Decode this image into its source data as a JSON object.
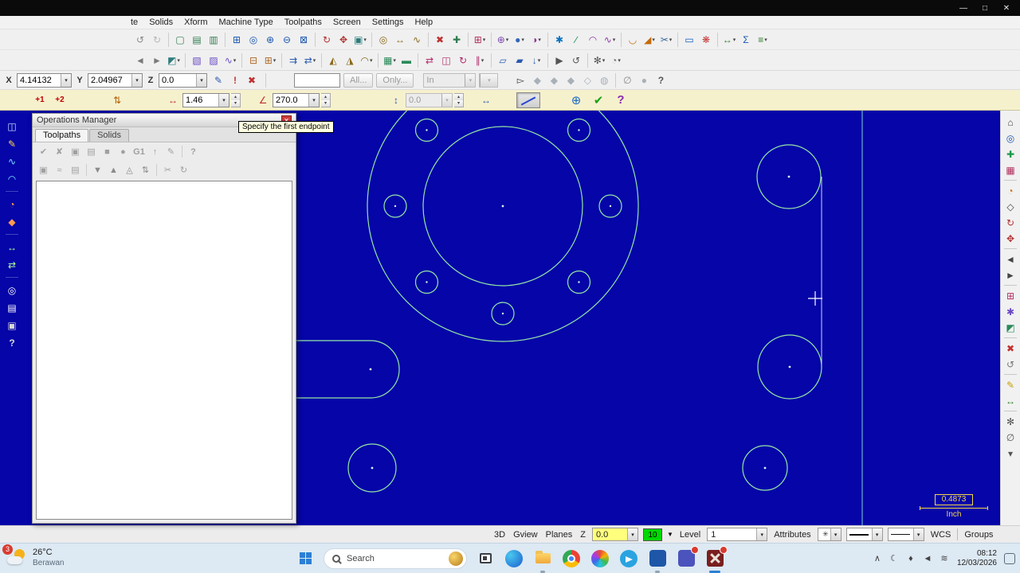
{
  "window": {
    "controls": [
      {
        "n": "minimize-button",
        "g": "—",
        "c": "#e8e8e8"
      },
      {
        "n": "maximize-button",
        "g": "□",
        "c": "#e8e8e8"
      },
      {
        "n": "close-button",
        "g": "✕",
        "c": "#e8e8e8"
      }
    ]
  },
  "menubar": {
    "items": [
      "te",
      "Solids",
      "Xform",
      "Machine Type",
      "Toolpaths",
      "Screen",
      "Settings",
      "Help"
    ]
  },
  "toolbar1": {
    "icons": [
      {
        "n": "undo-icon",
        "g": "↺",
        "c": "#8a8a8a"
      },
      {
        "n": "redo-icon",
        "g": "↻",
        "c": "#b8b8b8"
      },
      {
        "s": 1
      },
      {
        "n": "new-file-icon",
        "g": "▢",
        "c": "#2f7d4f"
      },
      {
        "n": "open-file-icon",
        "g": "▤",
        "c": "#2f7d4f"
      },
      {
        "n": "save-file-icon",
        "g": "▥",
        "c": "#2f7d4f"
      },
      {
        "s": 1
      },
      {
        "n": "zoom-window-icon",
        "g": "⊞",
        "c": "#1a56b0"
      },
      {
        "n": "zoom-target-icon",
        "g": "◎",
        "c": "#1a56b0"
      },
      {
        "n": "zoom-in-icon",
        "g": "⊕",
        "c": "#1a56b0"
      },
      {
        "n": "zoom-out-icon",
        "g": "⊖",
        "c": "#1a56b0"
      },
      {
        "n": "zoom-fit-icon",
        "g": "⊠",
        "c": "#1a56b0"
      },
      {
        "s": 1
      },
      {
        "n": "dynamic-rotate-icon",
        "g": "↻",
        "c": "#b03030"
      },
      {
        "n": "pan-icon",
        "g": "✥",
        "c": "#b03030"
      },
      {
        "n": "repaint-icon",
        "g": "▣",
        "c": "#2e7d7d",
        "d": 1
      },
      {
        "s": 1
      },
      {
        "n": "analyze-position-icon",
        "g": "◎",
        "c": "#8a6a1a"
      },
      {
        "n": "analyze-distance-icon",
        "g": "↔",
        "c": "#8a6a1a"
      },
      {
        "n": "analyze-dynamic-icon",
        "g": "∿",
        "c": "#8a6a1a"
      },
      {
        "s": 1
      },
      {
        "n": "delete-entities-icon",
        "g": "✖",
        "c": "#c03030"
      },
      {
        "n": "undelete-icon",
        "g": "✚",
        "c": "#2f7d4f"
      },
      {
        "s": 1
      },
      {
        "n": "grid-settings-icon",
        "g": "⊞",
        "c": "#b03060",
        "d": 1
      },
      {
        "s": 1
      },
      {
        "n": "wcs-origin-icon",
        "g": "⊕",
        "c": "#7a4ab0",
        "d": 1
      },
      {
        "n": "view-sphere-icon",
        "g": "●",
        "c": "#3366bb",
        "d": 1
      },
      {
        "n": "plane-select-icon",
        "g": "◑",
        "c": "#993399",
        "d": 1
      },
      {
        "s": 1
      },
      {
        "n": "create-point-icon",
        "g": "✱",
        "c": "#0a74c4"
      },
      {
        "n": "create-line-icon",
        "g": "∕",
        "c": "#0a8a4a"
      },
      {
        "n": "create-arc-icon",
        "g": "◠",
        "c": "#8a3aa0"
      },
      {
        "n": "create-spline-icon",
        "g": "∿",
        "c": "#8a3aa0",
        "d": 1
      },
      {
        "s": 1
      },
      {
        "n": "create-fillet-icon",
        "g": "◡",
        "c": "#c46a0a"
      },
      {
        "n": "create-chamfer-icon",
        "g": "◢",
        "c": "#c46a0a",
        "d": 1
      },
      {
        "n": "trim-break-icon",
        "g": "✂",
        "c": "#3a6aa0",
        "d": 1
      },
      {
        "s": 1
      },
      {
        "n": "create-rectangle-icon",
        "g": "▭",
        "c": "#0a5ac4"
      },
      {
        "n": "create-letters-icon",
        "g": "❋",
        "c": "#c43a3a"
      },
      {
        "s": 1
      },
      {
        "n": "dimension-icon",
        "g": "↔",
        "c": "#2a7d2a",
        "d": 1
      },
      {
        "n": "sigma-icon",
        "g": "Σ",
        "c": "#1a56b0"
      },
      {
        "n": "list-view-icon",
        "g": "≡",
        "c": "#2a7d2a",
        "d": 1
      }
    ]
  },
  "toolbar2": {
    "icons": [
      {
        "n": "prev-view-icon",
        "g": "◄",
        "c": "#7a7a7a"
      },
      {
        "n": "next-view-icon",
        "g": "►",
        "c": "#7a7a7a"
      },
      {
        "n": "view-manager-icon",
        "g": "◩",
        "c": "#2e7d7d",
        "d": 1
      },
      {
        "s": 1
      },
      {
        "n": "select-window-icon",
        "g": "▧",
        "c": "#6a4ac4"
      },
      {
        "n": "select-polygon-icon",
        "g": "▨",
        "c": "#6a4ac4"
      },
      {
        "n": "select-chain-icon",
        "g": "∿",
        "c": "#6a4ac4",
        "d": 1
      },
      {
        "s": 1
      },
      {
        "n": "group-create-icon",
        "g": "⊟",
        "c": "#b06a2a"
      },
      {
        "n": "group-manage-icon",
        "g": "⊞",
        "c": "#b06a2a",
        "d": 1
      },
      {
        "s": 1
      },
      {
        "n": "level-move-icon",
        "g": "⇉",
        "c": "#2a5ab0"
      },
      {
        "n": "level-copy-icon",
        "g": "⇄",
        "c": "#2a5ab0",
        "d": 1
      },
      {
        "s": 1
      },
      {
        "n": "solid-extrude-icon",
        "g": "◭",
        "c": "#8a6a1a"
      },
      {
        "n": "solid-revolve-icon",
        "g": "◮",
        "c": "#8a6a1a"
      },
      {
        "n": "solid-sweep-icon",
        "g": "◠",
        "c": "#8a6a1a",
        "d": 1
      },
      {
        "s": 1
      },
      {
        "n": "surface-net-icon",
        "g": "▦",
        "c": "#2a8a5a",
        "d": 1
      },
      {
        "n": "surface-flat-icon",
        "g": "▬",
        "c": "#2a8a5a"
      },
      {
        "s": 1
      },
      {
        "n": "xform-translate-icon",
        "g": "⇄",
        "c": "#b02a6a"
      },
      {
        "n": "xform-mirror-icon",
        "g": "◫",
        "c": "#b02a6a"
      },
      {
        "n": "xform-rotate-icon",
        "g": "↻",
        "c": "#b02a6a"
      },
      {
        "n": "xform-offset-icon",
        "g": "∥",
        "c": "#b02a6a",
        "d": 1
      },
      {
        "s": 1
      },
      {
        "n": "toolpath-contour-icon",
        "g": "▱",
        "c": "#2a5ab0"
      },
      {
        "n": "toolpath-pocket-icon",
        "g": "▰",
        "c": "#2a5ab0"
      },
      {
        "n": "toolpath-drill-icon",
        "g": "↓",
        "c": "#2a5ab0",
        "d": 1
      },
      {
        "s": 1
      },
      {
        "n": "machine-sim-icon",
        "g": "▶",
        "c": "#555555"
      },
      {
        "n": "backplot-icon",
        "g": "↺",
        "c": "#555555"
      },
      {
        "s": 1
      },
      {
        "n": "config-icon",
        "g": "✻",
        "c": "#555555",
        "d": 1
      },
      {
        "n": "ribbon-more-icon",
        "g": "◔",
        "c": "#777777",
        "d": 1
      }
    ]
  },
  "autocursor": {
    "x_label": "X",
    "x_value": "4.14132",
    "y_label": "Y",
    "y_value": "2.04967",
    "z_label": "Z",
    "z_value": "0.0",
    "all_label": "All...",
    "only_label": "Only...",
    "in_label": "In",
    "left_icons": [
      {
        "n": "fastpoint-icon",
        "g": "✎",
        "c": "#2a5ab0"
      },
      {
        "n": "autocursor-config-icon",
        "g": "!",
        "c": "#c03030",
        "k": "bold"
      },
      {
        "n": "override-icon",
        "g": "✖",
        "c": "#c03030"
      }
    ],
    "right_icons": [
      {
        "n": "select-arrow-icon",
        "g": "▻",
        "c": "#3a3a3a"
      },
      {
        "n": "quickmask-endpoint-icon",
        "g": "◆",
        "c": "#a8b0b8"
      },
      {
        "n": "quickmask-center-icon",
        "g": "◆",
        "c": "#a8b0b8"
      },
      {
        "n": "quickmask-intersect-icon",
        "g": "◆",
        "c": "#a8b0b8"
      },
      {
        "n": "quickmask-quadrant-icon",
        "g": "◇",
        "c": "#a8b0b8"
      },
      {
        "n": "select-inside-icon",
        "g": "◍",
        "c": "#a8b0b8"
      },
      {
        "s": 1
      },
      {
        "n": "select-none-icon",
        "g": "∅",
        "c": "#8a8a8a"
      },
      {
        "n": "select-sphere-icon",
        "g": "●",
        "c": "#a8b0b8"
      },
      {
        "n": "autocursor-help-icon",
        "g": "?",
        "c": "#555555",
        "k": "bold"
      }
    ]
  },
  "ribbon": {
    "length_value": "1.46",
    "angle_value": "270.0",
    "z_value": "0.0",
    "group1": [
      {
        "n": "first-endpoint-icon",
        "g": "+1",
        "c": "#c00000",
        "k": "wide"
      },
      {
        "n": "second-endpoint-icon",
        "g": "+2",
        "c": "#c00000",
        "k": "wide"
      }
    ],
    "group2": [
      {
        "n": "tangent-lines-icon",
        "g": "⇅",
        "c": "#b05a00"
      }
    ],
    "group3": [
      {
        "n": "length-icon",
        "g": "↔",
        "c": "#c03030"
      }
    ],
    "group4": [
      {
        "n": "angle-icon",
        "g": "∠",
        "c": "#c03030"
      }
    ],
    "group5": [
      {
        "n": "z-depth-icon",
        "g": "↕",
        "c": "#2a5ab0"
      }
    ],
    "group6": [
      {
        "n": "offset-direction-icon",
        "g": "↔",
        "c": "#2a5ab0"
      }
    ],
    "group7": [
      {
        "n": "apply-icon",
        "g": "⊕",
        "c": "#1a6ac4",
        "k": "big"
      },
      {
        "n": "ok-icon",
        "g": "✔",
        "c": "#17a317",
        "k": "big"
      },
      {
        "n": "ribbon-help-icon",
        "g": "?",
        "c": "#8a2ab0",
        "k": "big bold"
      }
    ]
  },
  "tooltip": {
    "text": "Specify the first endpoint"
  },
  "ops_manager": {
    "title": "Operations Manager",
    "tabs": [
      "Toolpaths",
      "Solids"
    ],
    "toolbar1": [
      {
        "n": "ops-select-all-icon",
        "g": "✔",
        "c": "#a0a0a0"
      },
      {
        "n": "ops-select-none-icon",
        "g": "✘",
        "c": "#a0a0a0"
      },
      {
        "n": "ops-toggle-lock-icon",
        "g": "▣",
        "c": "#a0a0a0"
      },
      {
        "n": "ops-toggle-post-icon",
        "g": "▤",
        "c": "#a0a0a0"
      },
      {
        "n": "ops-fill-icon",
        "g": "■",
        "c": "#a0a0a0"
      },
      {
        "n": "ops-circle-icon",
        "g": "●",
        "c": "#a0a0a0"
      },
      {
        "n": "ops-g1-icon",
        "g": "G1",
        "c": "#a0a0a0",
        "k": "wide"
      },
      {
        "n": "ops-post-icon",
        "g": "↑",
        "c": "#a0a0a0"
      },
      {
        "n": "ops-edit-icon",
        "g": "✎",
        "c": "#a0a0a0"
      },
      {
        "s": 1
      },
      {
        "n": "ops-help-icon",
        "g": "?",
        "c": "#a0a0a0",
        "k": "bold"
      }
    ],
    "toolbar2": [
      {
        "n": "ops-lock-icon",
        "g": "▣",
        "c": "#a0a0a0"
      },
      {
        "n": "ops-wave-icon",
        "g": "≈",
        "c": "#a0a0a0"
      },
      {
        "n": "ops-save-icon",
        "g": "▤",
        "c": "#a0a0a0"
      },
      {
        "s": 1
      },
      {
        "n": "ops-move-down-icon",
        "g": "▼",
        "c": "#8a8a8a"
      },
      {
        "n": "ops-move-up-icon",
        "g": "▲",
        "c": "#8a8a8a"
      },
      {
        "n": "ops-insert-icon",
        "g": "◬",
        "c": "#8a8a8a"
      },
      {
        "n": "ops-swap-icon",
        "g": "⇅",
        "c": "#8a8a8a"
      },
      {
        "s": 1
      },
      {
        "n": "ops-cut-icon",
        "g": "✂",
        "c": "#a0a0a0"
      },
      {
        "n": "ops-regen-icon",
        "g": "↻",
        "c": "#a0a0a0"
      }
    ]
  },
  "left_toolbar": {
    "icons": [
      {
        "n": "side-analyze-icon",
        "g": "◫",
        "c": "#cfe0ff"
      },
      {
        "n": "side-sketch-icon",
        "g": "✎",
        "c": "#ffd34d"
      },
      {
        "n": "side-curve-icon",
        "g": "∿",
        "c": "#7ae0ff"
      },
      {
        "n": "side-arc-icon",
        "g": "◠",
        "c": "#7ae0ff"
      },
      {
        "s": 1
      },
      {
        "n": "side-surface-icon",
        "g": "◔",
        "c": "#ff9a4d"
      },
      {
        "n": "side-solid-icon",
        "g": "◆",
        "c": "#ff9a4d"
      },
      {
        "s": 1
      },
      {
        "n": "side-dimension-icon",
        "g": "↔",
        "c": "#b0ff9a"
      },
      {
        "n": "side-xform-icon",
        "g": "⇄",
        "c": "#b0ff9a"
      },
      {
        "s": 1
      },
      {
        "n": "side-view-icon",
        "g": "◎",
        "c": "#ffffff"
      },
      {
        "n": "side-level-icon",
        "g": "▤",
        "c": "#ffffff"
      },
      {
        "n": "side-screen-icon",
        "g": "▣",
        "c": "#d8d8d8"
      },
      {
        "n": "side-help-icon",
        "g": "?",
        "c": "#d8d8d8",
        "k": "bold"
      }
    ]
  },
  "right_toolbar": {
    "icons": [
      {
        "n": "fit-screen-icon",
        "g": "⌂",
        "c": "#444444"
      },
      {
        "n": "zoom-selected-icon",
        "g": "◎",
        "c": "#1a56b0"
      },
      {
        "n": "repaint-screen-icon",
        "g": "✚",
        "c": "#1a9a4a"
      },
      {
        "n": "blank-entity-icon",
        "g": "▦",
        "c": "#b03060"
      },
      {
        "s": 1
      },
      {
        "n": "shade-icon",
        "g": "◔",
        "c": "#c46a0a"
      },
      {
        "n": "wireframe-icon",
        "g": "◇",
        "c": "#444444"
      },
      {
        "n": "rotate-view-icon",
        "g": "↻",
        "c": "#b03030"
      },
      {
        "n": "pan-view-icon",
        "g": "✥",
        "c": "#b03030"
      },
      {
        "s": 1
      },
      {
        "n": "previous-view-icon",
        "g": "◄",
        "c": "#444444"
      },
      {
        "n": "next-view2-icon",
        "g": "►",
        "c": "#444444"
      },
      {
        "s": 1
      },
      {
        "n": "grid-toggle-icon",
        "g": "⊞",
        "c": "#b03060"
      },
      {
        "n": "attributes-icon",
        "g": "✱",
        "c": "#6a4ac4"
      },
      {
        "n": "color-cycle-icon",
        "g": "◩",
        "c": "#2a8a5a"
      },
      {
        "s": 1
      },
      {
        "n": "delete-selected-icon",
        "g": "✖",
        "c": "#c03030"
      },
      {
        "n": "undo-view-icon",
        "g": "↺",
        "c": "#777777"
      },
      {
        "s": 1
      },
      {
        "n": "note-tool-icon",
        "g": "✎",
        "c": "#c4a00a"
      },
      {
        "n": "measure-tool-icon",
        "g": "↔",
        "c": "#2a7d2a"
      },
      {
        "s": 1
      },
      {
        "n": "settings-tool-icon",
        "g": "✻",
        "c": "#555555"
      },
      {
        "n": "hide-tool-icon",
        "g": "∅",
        "c": "#555555"
      },
      {
        "n": "more-tools-icon",
        "g": "▾",
        "c": "#555555"
      }
    ]
  },
  "drawing": {
    "scale_value": "0.4873",
    "scale_unit": "Inch"
  },
  "statusbar": {
    "view_3d": "3D",
    "gview_label": "Gview",
    "planes_label": "Planes",
    "z_label": "Z",
    "z_value": "0.0",
    "color_value": "10",
    "level_label": "Level",
    "level_value": "1",
    "attributes_label": "Attributes",
    "point_style_glyph": "✳",
    "wcs_label": "WCS",
    "groups_label": "Groups"
  },
  "taskbar": {
    "weather": {
      "temp": "26°C",
      "desc": "Berawan",
      "badge": "3"
    },
    "search_placeholder": "Search",
    "time": "08:12",
    "date": "12/03/2026",
    "tray_icons": [
      {
        "n": "hidden-icons-chevron",
        "g": "∧",
        "c": "#444444"
      },
      {
        "n": "night-light-icon",
        "g": "☾",
        "c": "#444444"
      },
      {
        "n": "microphone-icon",
        "g": "♦",
        "c": "#444444"
      },
      {
        "n": "volume-icon",
        "g": "◄",
        "c": "#444444"
      },
      {
        "n": "network-icon",
        "g": "≋",
        "c": "#444444"
      }
    ]
  }
}
